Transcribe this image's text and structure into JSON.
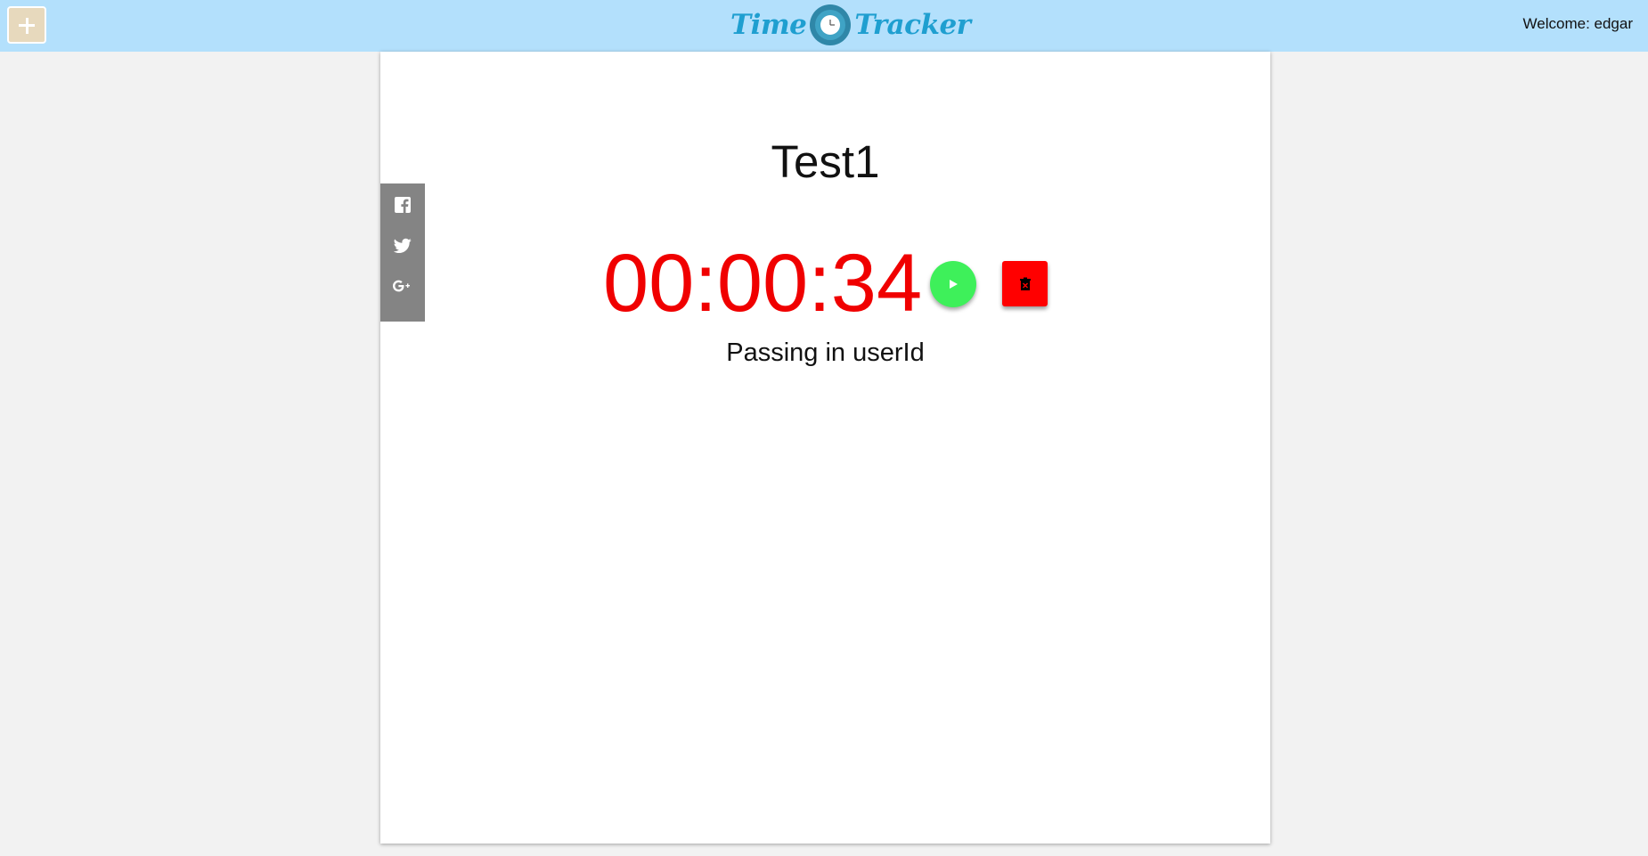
{
  "header": {
    "logo_left": "Time",
    "logo_right": "Tracker",
    "welcome": "Welcome: edgar",
    "add_icon": "plus-icon",
    "background": "#b3e0fc"
  },
  "social": {
    "icons": [
      "facebook-icon",
      "twitter-icon",
      "google-plus-icon"
    ]
  },
  "timer": {
    "name": "Test1",
    "elapsed": "00:00:34",
    "description": "Passing in userId",
    "elapsed_color": "#f00000",
    "play_icon": "play-icon",
    "play_color": "#3ef05a",
    "delete_icon": "trash-icon",
    "delete_color": "#ff0000"
  }
}
